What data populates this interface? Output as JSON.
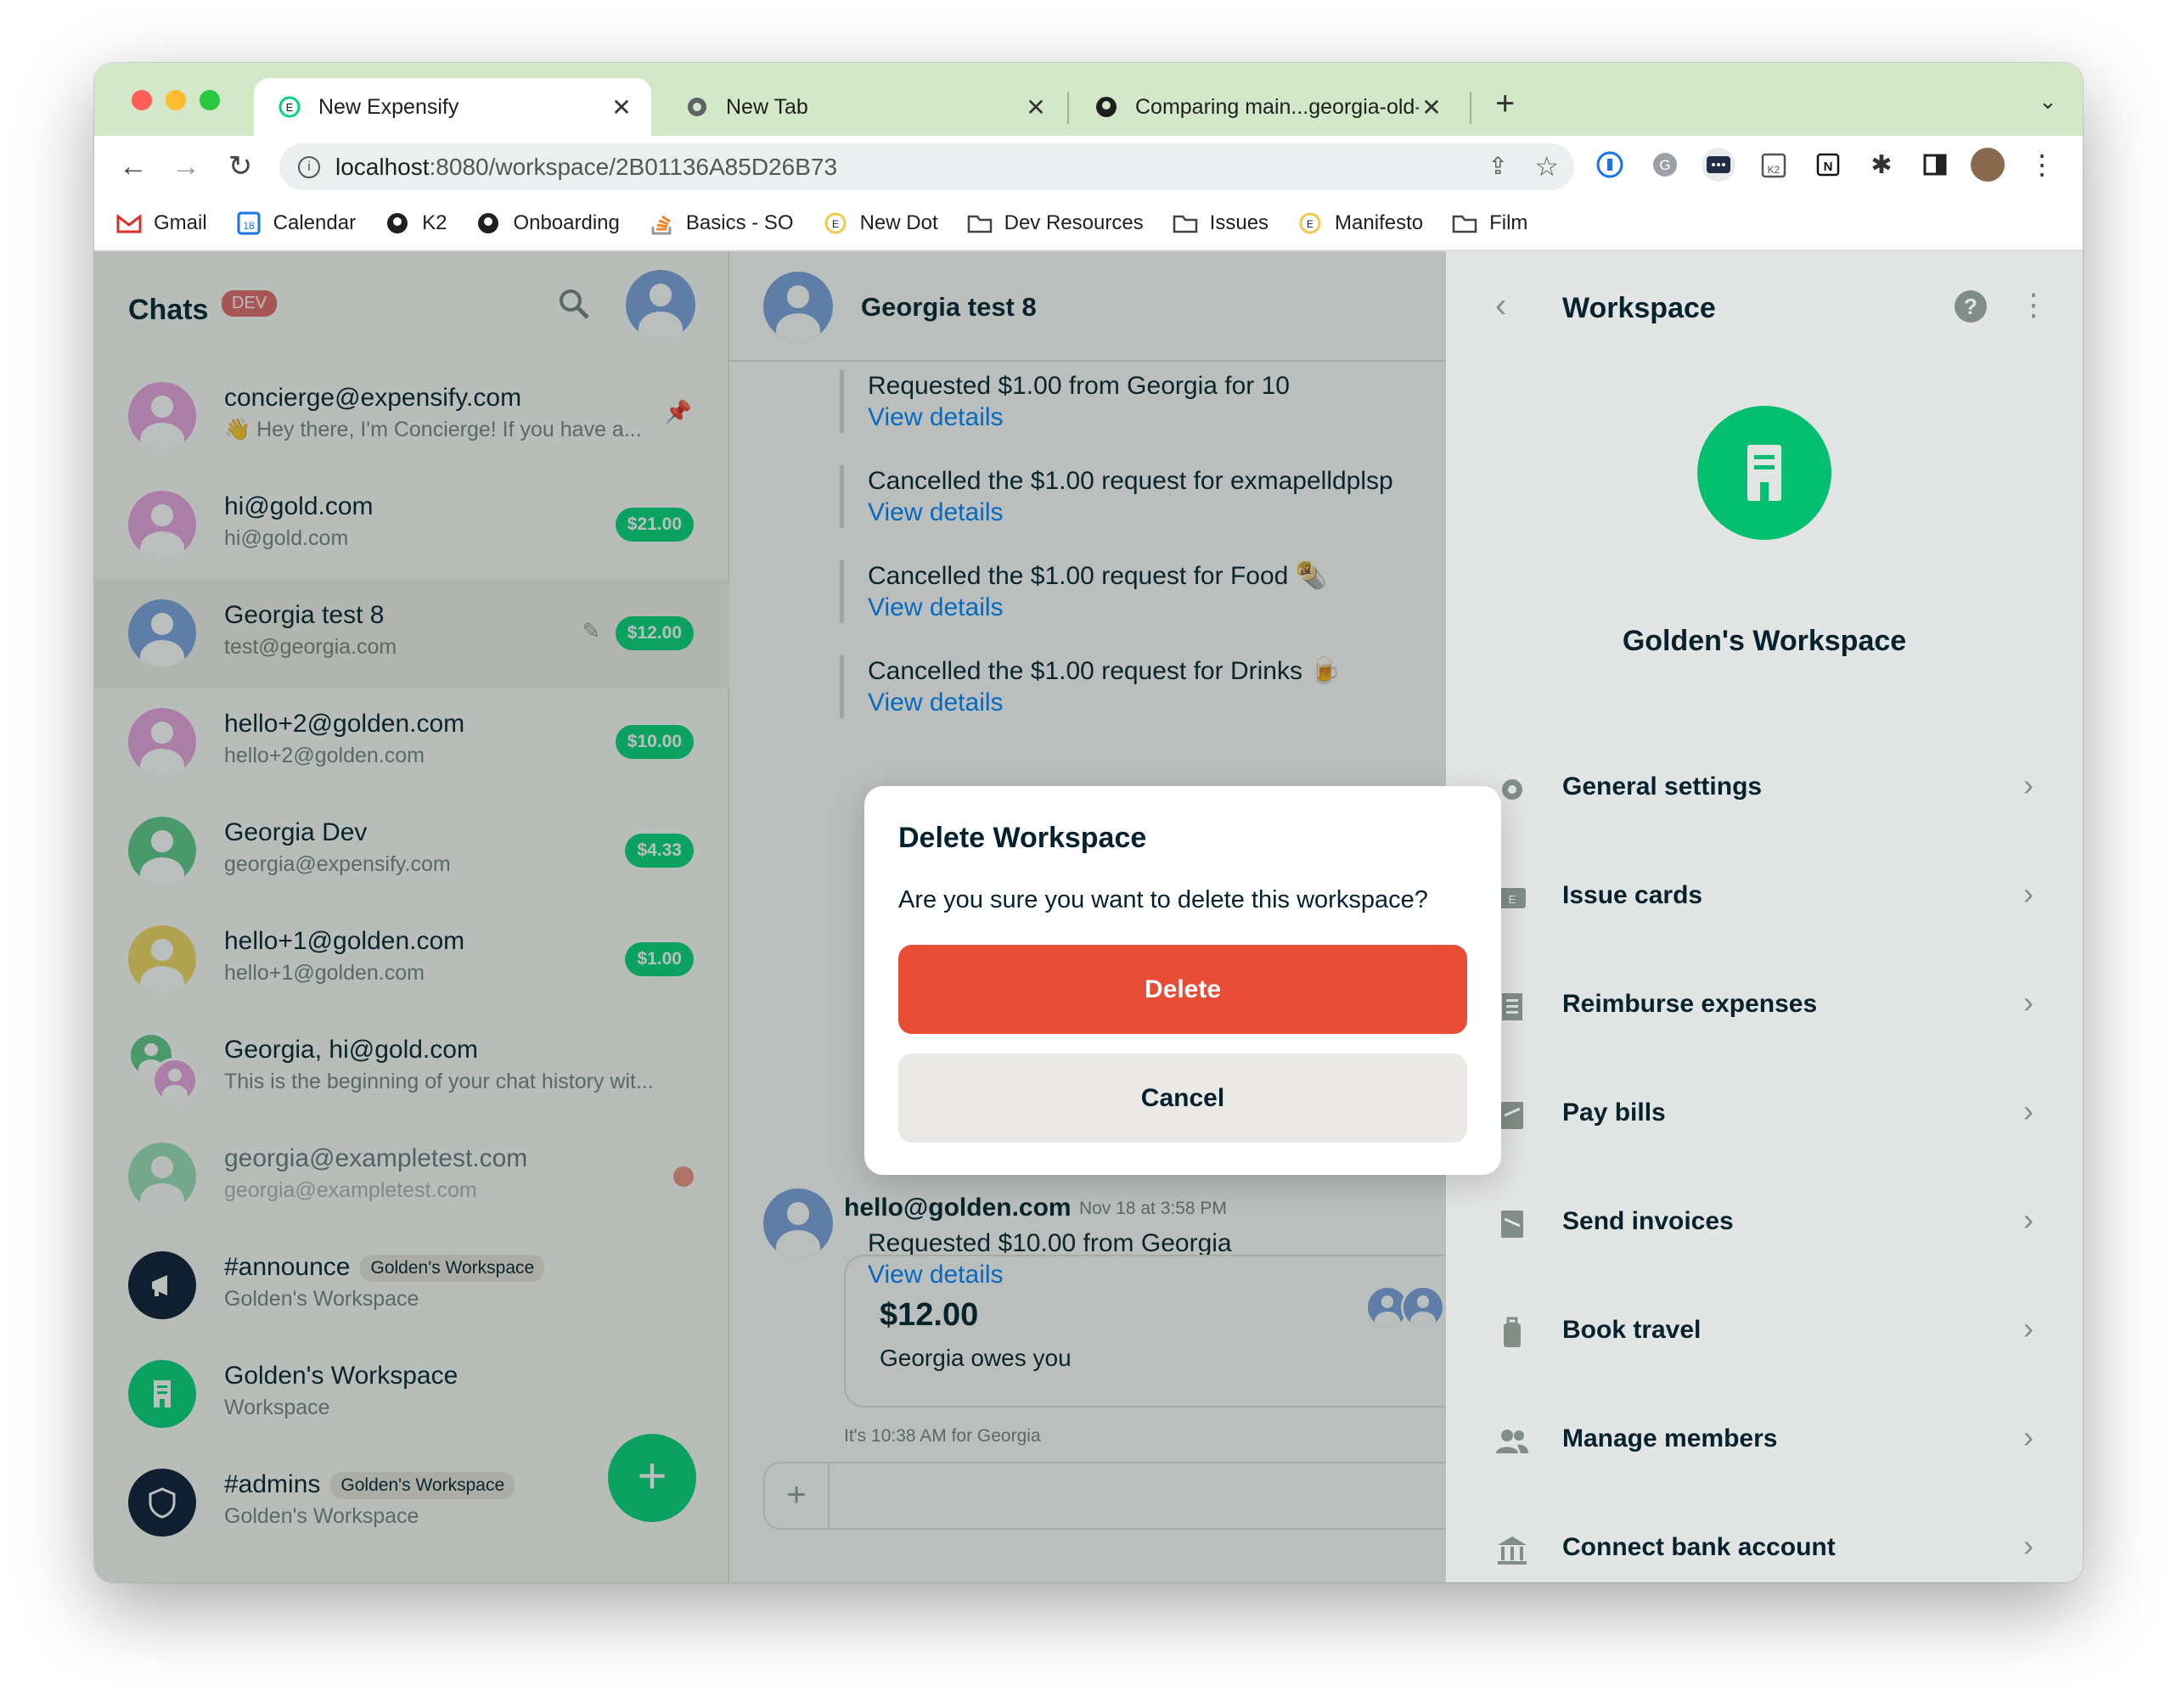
{
  "browser": {
    "tabs": [
      {
        "title": "New Expensify",
        "active": true
      },
      {
        "title": "New Tab",
        "active": false
      },
      {
        "title": "Comparing main...georgia-old-",
        "active": false
      }
    ],
    "url_host": "localhost",
    "url_path": ":8080/workspace/2B01136A85D26B73",
    "bookmarks": [
      "Gmail",
      "Calendar",
      "K2",
      "Onboarding",
      "Basics - SO",
      "New Dot",
      "Dev Resources",
      "Issues",
      "Manifesto",
      "Film"
    ],
    "calendar_day": "18"
  },
  "sidebar": {
    "title": "Chats",
    "badge": "DEV",
    "chats": [
      {
        "name": "concierge@expensify.com",
        "subtitle": "👋 Hey there, I'm Concierge! If you have a...",
        "color": "#e8a3e0"
      },
      {
        "name": "hi@gold.com",
        "subtitle": "hi@gold.com",
        "amount": "$21.00",
        "color": "#e8a3e0"
      },
      {
        "name": "Georgia test 8",
        "subtitle": "test@georgia.com",
        "amount": "$12.00",
        "color": "#7da2e0"
      },
      {
        "name": "hello+2@golden.com",
        "subtitle": "hello+2@golden.com",
        "amount": "$10.00",
        "color": "#e8a3e0"
      },
      {
        "name": "Georgia Dev",
        "subtitle": "georgia@expensify.com",
        "amount": "$4.33",
        "color": "#5fc98a"
      },
      {
        "name": "hello+1@golden.com",
        "subtitle": "hello+1@golden.com",
        "amount": "$1.00",
        "color": "#f2d663"
      },
      {
        "name": "Georgia, hi@gold.com",
        "subtitle": "This is the beginning of your chat history wit...",
        "color": "#e8a3e0"
      },
      {
        "name": "georgia@exampletest.com",
        "subtitle": "georgia@exampletest.com",
        "color": "#9ad8b0"
      },
      {
        "name": "#announce",
        "tag": "Golden's Workspace",
        "subtitle": "Golden's Workspace",
        "color": "#0b1b34"
      },
      {
        "name": "Golden's Workspace",
        "subtitle": "Workspace",
        "color": "#03d47c"
      },
      {
        "name": "#admins",
        "tag": "Golden's Workspace",
        "subtitle": "Golden's Workspace",
        "color": "#0b1b34"
      }
    ]
  },
  "chat": {
    "title": "Georgia test 8",
    "messages": [
      {
        "text": "Requested $1.00 from Georgia for 10",
        "link": "View details"
      },
      {
        "text": "Cancelled the $1.00 request for exmapelldplsp",
        "link": "View details"
      },
      {
        "text": "Cancelled the $1.00 request for Food 🌯",
        "link": "View details"
      },
      {
        "text": "Cancelled the $1.00 request for Drinks 🍺",
        "link": "View details"
      }
    ],
    "last_sender": "hello@golden.com",
    "last_time": "Nov 18 at 3:58 PM",
    "last_text": "Requested $10.00 from Georgia",
    "last_link": "View details",
    "card_amount": "$12.00",
    "card_text": "Georgia owes you",
    "local_time": "It's 10:38 AM for Georgia"
  },
  "modal": {
    "title": "Delete Workspace",
    "body": "Are you sure you want to delete this workspace?",
    "delete_label": "Delete",
    "cancel_label": "Cancel"
  },
  "workspace": {
    "header": "Workspace",
    "name": "Golden's Workspace",
    "menu": [
      {
        "label": "General settings",
        "icon": "gear-icon"
      },
      {
        "label": "Issue cards",
        "icon": "card-icon"
      },
      {
        "label": "Reimburse expenses",
        "icon": "receipt-icon"
      },
      {
        "label": "Pay bills",
        "icon": "bill-icon"
      },
      {
        "label": "Send invoices",
        "icon": "invoice-icon"
      },
      {
        "label": "Book travel",
        "icon": "luggage-icon"
      },
      {
        "label": "Manage members",
        "icon": "users-icon"
      },
      {
        "label": "Connect bank account",
        "icon": "bank-icon"
      }
    ]
  },
  "colors": {
    "green": "#03d47c",
    "danger": "#e84c34",
    "link": "#0185ff",
    "text": "#03212f"
  }
}
